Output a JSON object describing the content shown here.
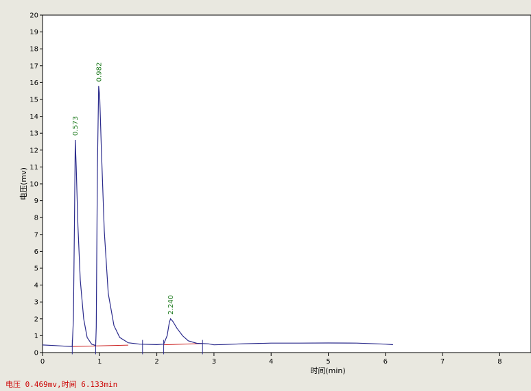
{
  "chart_data": {
    "type": "line",
    "xlabel": "时间(min)",
    "ylabel": "电压(mv)",
    "xlim": [
      0,
      8.5
    ],
    "ylim": [
      0,
      20
    ],
    "x_ticks": [
      0,
      1,
      2,
      3,
      4,
      5,
      6,
      7,
      8
    ],
    "y_ticks": [
      0,
      1,
      2,
      3,
      4,
      5,
      6,
      7,
      8,
      9,
      10,
      11,
      12,
      13,
      14,
      15,
      16,
      17,
      18,
      19,
      20
    ],
    "grid": false,
    "colors": {
      "trace": "#2b2b8c",
      "baseline": "#cc2222",
      "peak_label": "#1e7b1e",
      "axis": "#000000"
    },
    "series": [
      {
        "points": [
          [
            0.0,
            0.45
          ],
          [
            0.2,
            0.42
          ],
          [
            0.4,
            0.38
          ],
          [
            0.52,
            0.36
          ],
          [
            0.54,
            2.0
          ],
          [
            0.56,
            8.0
          ],
          [
            0.573,
            12.6
          ],
          [
            0.59,
            11.0
          ],
          [
            0.62,
            7.5
          ],
          [
            0.66,
            4.3
          ],
          [
            0.72,
            2.0
          ],
          [
            0.78,
            0.9
          ],
          [
            0.86,
            0.5
          ],
          [
            0.93,
            0.42
          ],
          [
            0.94,
            1.5
          ],
          [
            0.96,
            11.0
          ],
          [
            0.982,
            15.8
          ],
          [
            1.0,
            15.2
          ],
          [
            1.03,
            12.0
          ],
          [
            1.08,
            7.2
          ],
          [
            1.15,
            3.5
          ],
          [
            1.25,
            1.6
          ],
          [
            1.35,
            0.9
          ],
          [
            1.5,
            0.58
          ],
          [
            1.7,
            0.5
          ],
          [
            2.0,
            0.47
          ],
          [
            2.12,
            0.5
          ],
          [
            2.18,
            1.0
          ],
          [
            2.22,
            1.8
          ],
          [
            2.24,
            2.0
          ],
          [
            2.28,
            1.85
          ],
          [
            2.35,
            1.45
          ],
          [
            2.45,
            1.0
          ],
          [
            2.55,
            0.7
          ],
          [
            2.7,
            0.55
          ],
          [
            2.9,
            0.52
          ],
          [
            3.0,
            0.46
          ],
          [
            3.2,
            0.48
          ],
          [
            3.5,
            0.52
          ],
          [
            4.0,
            0.56
          ],
          [
            4.5,
            0.56
          ],
          [
            5.0,
            0.57
          ],
          [
            5.5,
            0.56
          ],
          [
            6.0,
            0.5
          ],
          [
            6.133,
            0.469
          ]
        ]
      }
    ],
    "baselines": [
      [
        [
          0.52,
          0.36
        ],
        [
          1.5,
          0.44
        ]
      ],
      [
        [
          2.12,
          0.46
        ],
        [
          2.8,
          0.54
        ]
      ]
    ],
    "peaks": [
      {
        "x": 0.573,
        "y": 12.6,
        "label": "0.573"
      },
      {
        "x": 0.982,
        "y": 15.8,
        "label": "0.982"
      },
      {
        "x": 2.24,
        "y": 2.0,
        "label": "2.240"
      }
    ],
    "markers_x": [
      0.52,
      0.93,
      1.75,
      2.12,
      2.8
    ]
  },
  "status": {
    "text": "电压 0.469mv,时间 6.133min"
  }
}
